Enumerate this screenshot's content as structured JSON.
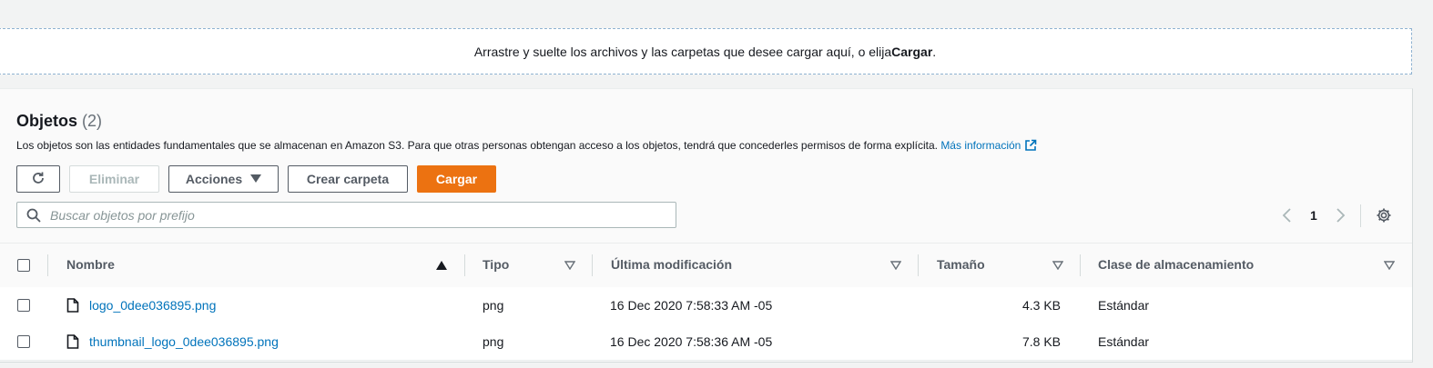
{
  "dropzone": {
    "text_before": "Arrastre y suelte los archivos y las carpetas que desee cargar aquí, o elija ",
    "text_bold": "Cargar",
    "text_after": "."
  },
  "objects": {
    "title": "Objetos",
    "count": "(2)",
    "description": "Los objetos son las entidades fundamentales que se almacenan en Amazon S3. Para que otras personas obtengan acceso a los objetos, tendrá que concederles permisos de forma explícita. ",
    "more_info": "Más información"
  },
  "toolbar": {
    "refresh_icon": "refresh-icon",
    "delete_label": "Eliminar",
    "actions_label": "Acciones",
    "create_folder_label": "Crear carpeta",
    "upload_label": "Cargar"
  },
  "search": {
    "placeholder": "Buscar objetos por prefijo",
    "value": ""
  },
  "pagination": {
    "current_page": "1"
  },
  "table": {
    "columns": {
      "name": "Nombre",
      "type": "Tipo",
      "modified": "Última modificación",
      "size": "Tamaño",
      "storage_class": "Clase de almacenamiento"
    },
    "rows": [
      {
        "name": "logo_0dee036895.png",
        "type": "png",
        "modified": "16 Dec 2020 7:58:33 AM -05",
        "size": "4.3 KB",
        "storage_class": "Estándar"
      },
      {
        "name": "thumbnail_logo_0dee036895.png",
        "type": "png",
        "modified": "16 Dec 2020 7:58:36 AM -05",
        "size": "7.8 KB",
        "storage_class": "Estándar"
      }
    ]
  },
  "colors": {
    "primary": "#ec7211",
    "link": "#0073bb"
  }
}
